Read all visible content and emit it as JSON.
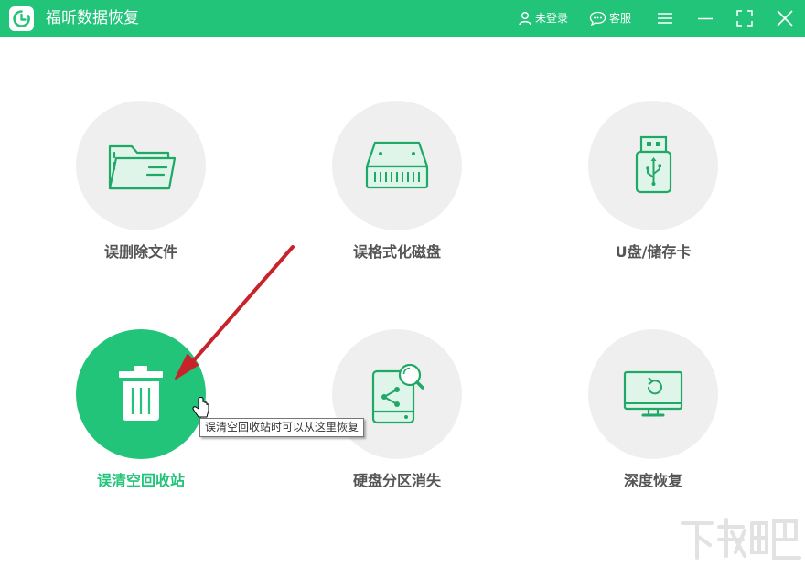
{
  "app": {
    "title": "福昕数据恢复"
  },
  "titlebar": {
    "login_label": "未登录",
    "service_label": "客服"
  },
  "tiles": [
    {
      "label": "误删除文件",
      "icon": "folder-icon"
    },
    {
      "label": "误格式化磁盘",
      "icon": "hard-drive-icon"
    },
    {
      "label": "U盘/储存卡",
      "icon": "usb-drive-icon"
    },
    {
      "label": "误清空回收站",
      "icon": "trash-icon",
      "active": true
    },
    {
      "label": "硬盘分区消失",
      "icon": "disk-search-icon"
    },
    {
      "label": "深度恢复",
      "icon": "monitor-restore-icon"
    }
  ],
  "tooltip": {
    "text": "误清空回收站时可以从这里恢复"
  },
  "colors": {
    "accent": "#22c47a",
    "icon_green": "#1fa866",
    "icon_fill": "#dff5ea",
    "circle_bg": "#efefef",
    "label": "#555555"
  }
}
